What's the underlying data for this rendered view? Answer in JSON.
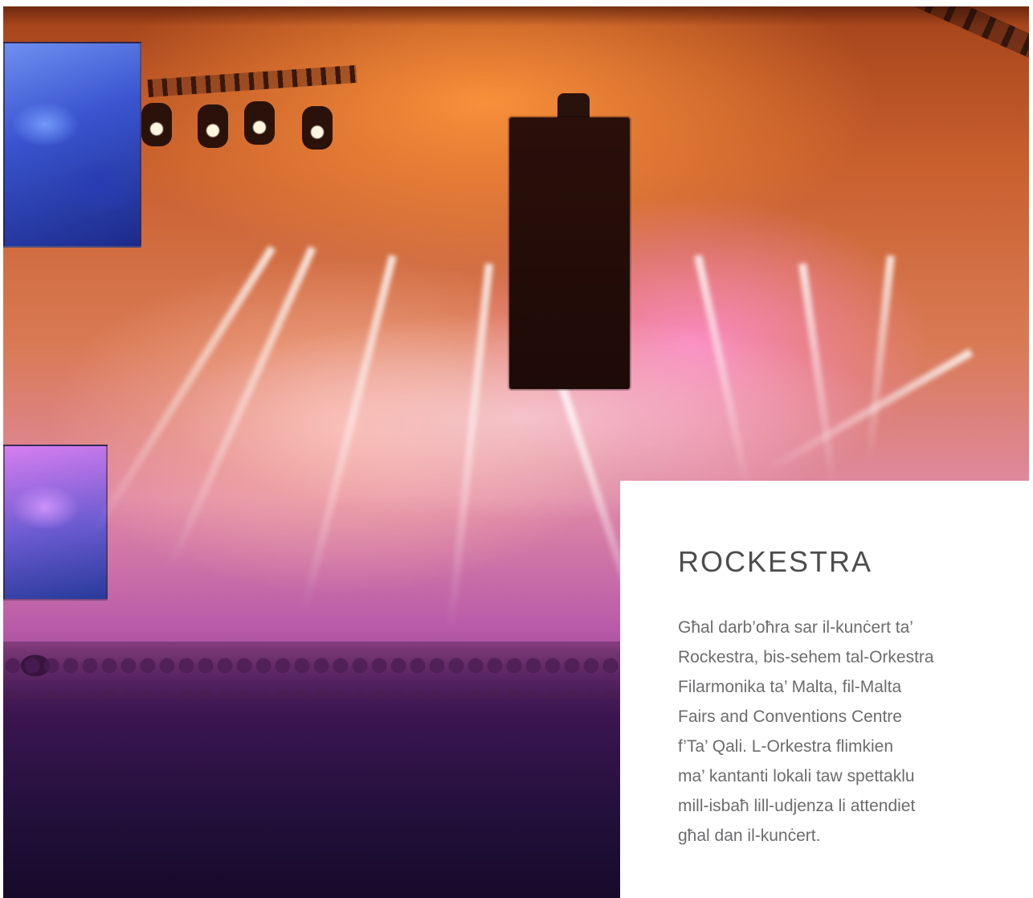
{
  "article": {
    "title": "ROCKESTRA",
    "body_lines": [
      "Għal darb’oħra sar il-kunċert ta’",
      "Rockestra, bis-sehem tal-Orkestra",
      "Filarmonika ta’ Malta, fil-Malta",
      "Fairs and Conventions Centre",
      "f’Ta’ Qali. L-Orkestra flimkien",
      "ma’ kantanti lokali taw spettaklu",
      "mill-isbaħ lill-udjenza li attendiet",
      "għal dan il-kunċert."
    ]
  }
}
